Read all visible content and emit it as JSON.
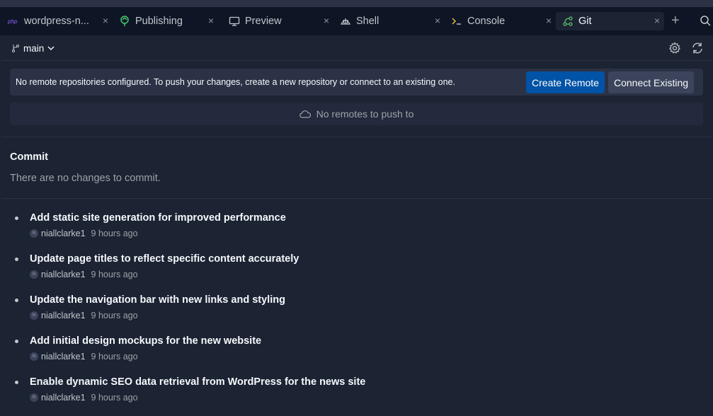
{
  "tabs": [
    {
      "label": "wordpress-n...",
      "icon": "php-icon",
      "active": false
    },
    {
      "label": "Publishing",
      "icon": "publishing-icon",
      "active": false
    },
    {
      "label": "Preview",
      "icon": "monitor-icon",
      "active": false
    },
    {
      "label": "Shell",
      "icon": "shell-icon",
      "active": false
    },
    {
      "label": "Console",
      "icon": "terminal-prompt-icon",
      "active": false
    },
    {
      "label": "Git",
      "icon": "git-icon",
      "active": true
    }
  ],
  "tab_close_glyph": "×",
  "add_tab_glyph": "+",
  "php_badge": "php",
  "branch": {
    "name": "main"
  },
  "notice": {
    "message": "No remote repositories configured. To push your changes, create a new repository or connect to an existing one.",
    "create_label": "Create Remote",
    "connect_label": "Connect Existing"
  },
  "no_remotes": "No remotes to push to",
  "commit": {
    "title": "Commit",
    "empty_message": "There are no changes to commit."
  },
  "history": [
    {
      "message": "Add static site generation for improved performance",
      "author": "niallclarke1",
      "time": "9 hours ago",
      "avatar": "N"
    },
    {
      "message": "Update page titles to reflect specific content accurately",
      "author": "niallclarke1",
      "time": "9 hours ago",
      "avatar": "N"
    },
    {
      "message": "Update the navigation bar with new links and styling",
      "author": "niallclarke1",
      "time": "9 hours ago",
      "avatar": "N"
    },
    {
      "message": "Add initial design mockups for the new website",
      "author": "niallclarke1",
      "time": "9 hours ago",
      "avatar": "N"
    },
    {
      "message": "Enable dynamic SEO data retrieval from WordPress for the news site",
      "author": "niallclarke1",
      "time": "9 hours ago",
      "avatar": "N"
    }
  ],
  "colors": {
    "background": "#1c2333",
    "tabbar": "#0e1525",
    "primary_button": "#0053a6",
    "git_icon": "#5ac06b",
    "publishing_icon": "#46c46f",
    "php_icon": "#8c61ff"
  }
}
